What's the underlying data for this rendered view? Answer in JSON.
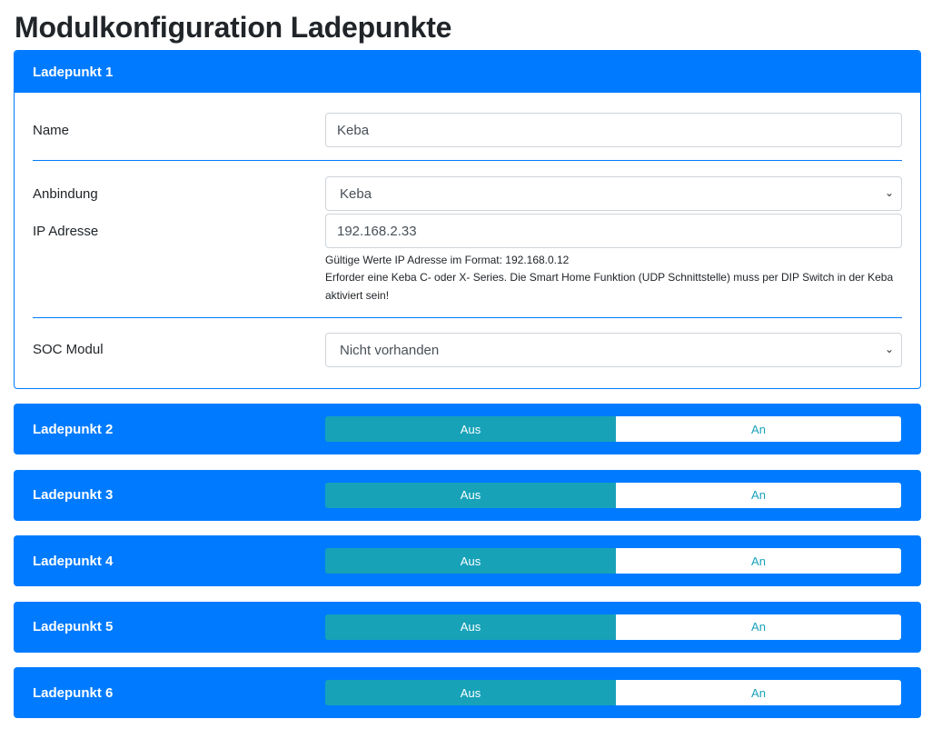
{
  "title": "Modulkonfiguration Ladepunkte",
  "lp1": {
    "header": "Ladepunkt 1",
    "name_label": "Name",
    "name_value": "Keba",
    "anbindung_label": "Anbindung",
    "anbindung_value": "Keba",
    "ip_label": "IP Adresse",
    "ip_value": "192.168.2.33",
    "help1": "Gültige Werte IP Adresse im Format: 192.168.0.12",
    "help2": "Erforder eine Keba C- oder X- Series. Die Smart Home Funktion (UDP Schnittstelle) muss per DIP Switch in der Keba aktiviert sein!",
    "soc_label": "SOC Modul",
    "soc_value": "Nicht vorhanden"
  },
  "others": [
    {
      "label": "Ladepunkt 2",
      "off": "Aus",
      "on": "An",
      "state": "Aus"
    },
    {
      "label": "Ladepunkt 3",
      "off": "Aus",
      "on": "An",
      "state": "Aus"
    },
    {
      "label": "Ladepunkt 4",
      "off": "Aus",
      "on": "An",
      "state": "Aus"
    },
    {
      "label": "Ladepunkt 5",
      "off": "Aus",
      "on": "An",
      "state": "Aus"
    },
    {
      "label": "Ladepunkt 6",
      "off": "Aus",
      "on": "An",
      "state": "Aus"
    }
  ],
  "colors": {
    "primary": "#007bff",
    "toggle_active": "#17a2b8"
  }
}
